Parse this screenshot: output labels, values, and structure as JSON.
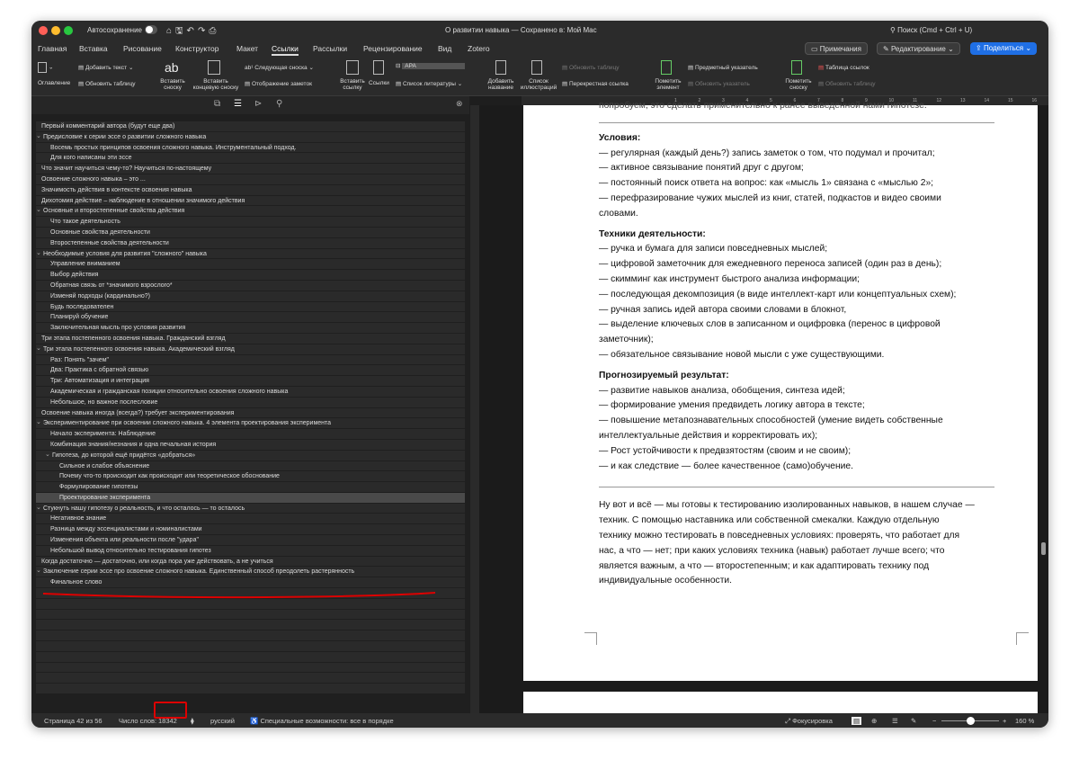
{
  "titlebar": {
    "autosave": "Автосохранение",
    "doc_title": "О развитии навыка — Сохранено в: Мой Mac",
    "search": "Поиск (Cmd + Ctrl + U)"
  },
  "menu": {
    "tabs": [
      "Главная",
      "Вставка",
      "Рисование",
      "Конструктор",
      "Макет",
      "Ссылки",
      "Рассылки",
      "Рецензирование",
      "Вид",
      "Zotero"
    ],
    "active_tab": "Ссылки",
    "comments": "Примечания",
    "editing": "Редактирование",
    "share": "Поделиться"
  },
  "ribbon": {
    "toc": "Оглавление",
    "add_text": "Добавить текст",
    "update_table": "Обновить таблицу",
    "insert_footnote": "Вставить сноску",
    "insert_endnote": "Вставить концевую сноску",
    "next_footnote": "Следующая сноска",
    "show_notes": "Отображение заметок",
    "insert_citation": "Вставить ссылку",
    "citations": "Ссылки",
    "style": "APA",
    "bibliography": "Список литературы",
    "add_caption": "Добавить название",
    "list_illustrations": "Список иллюстраций",
    "update_table2": "Обновить таблицу",
    "cross_ref": "Перекрестная ссылка",
    "mark_entry": "Пометить элемент",
    "subject_index": "Предметный указатель",
    "update_index": "Обновить указатель",
    "mark_citation": "Пометить сноску",
    "table_auth": "Таблица ссылок",
    "update_table3": "Обновить таблицу"
  },
  "ruler_ticks": [
    "1",
    "2",
    "3",
    "4",
    "5",
    "6",
    "7",
    "8",
    "9",
    "10",
    "11",
    "12",
    "13",
    "14",
    "15",
    "16",
    "17"
  ],
  "nav": {
    "items": [
      {
        "t": "Первый комментарий автора (будут еще два)",
        "l": 0,
        "c": false
      },
      {
        "t": "Предисловие к серии эссе о развитии сложного навыка",
        "l": 0,
        "c": true
      },
      {
        "t": "Восемь простых принципов освоения сложного навыка. Инструментальный подход.",
        "l": 1,
        "c": false
      },
      {
        "t": "Для кого написаны эти эссе",
        "l": 1,
        "c": false
      },
      {
        "t": "Что значит научиться чему-то? Научиться по-настоящему",
        "l": 0,
        "c": false
      },
      {
        "t": "Освоение сложного навыка – это ...",
        "l": 0,
        "c": false
      },
      {
        "t": "Значимость действия в контексте освоения навыка",
        "l": 0,
        "c": false
      },
      {
        "t": "Дихотомия действие – наблюдение в отношении значимого действия",
        "l": 0,
        "c": false
      },
      {
        "t": "Основные и второстепенные свойства действия",
        "l": 0,
        "c": true
      },
      {
        "t": "Что такое деятельность",
        "l": 1,
        "c": false
      },
      {
        "t": "Основные свойства деятельности",
        "l": 1,
        "c": false
      },
      {
        "t": "Второстепенные свойства деятельности",
        "l": 1,
        "c": false
      },
      {
        "t": "Необходимые условия для развития \"сложного\" навыка",
        "l": 0,
        "c": true
      },
      {
        "t": "Управление вниманием",
        "l": 1,
        "c": false
      },
      {
        "t": "Выбор действия",
        "l": 1,
        "c": false
      },
      {
        "t": "Обратная связь от *значимого взрослого*",
        "l": 1,
        "c": false
      },
      {
        "t": "Изменяй подходы (кардинально?)",
        "l": 1,
        "c": false
      },
      {
        "t": "Будь последователен",
        "l": 1,
        "c": false
      },
      {
        "t": "Планируй обучение",
        "l": 1,
        "c": false
      },
      {
        "t": "Заключительная мысль про условия развития",
        "l": 1,
        "c": false
      },
      {
        "t": "Три этапа постепенного освоения навыка. Гражданский взгляд",
        "l": 0,
        "c": false
      },
      {
        "t": "Три этапа постепенного освоения навыка. Академический взгляд",
        "l": 0,
        "c": true
      },
      {
        "t": "Раз: Понять \"зачем\"",
        "l": 1,
        "c": false
      },
      {
        "t": "Два: Практика с обратной связью",
        "l": 1,
        "c": false
      },
      {
        "t": "Три: Автоматизация и интеграция",
        "l": 1,
        "c": false
      },
      {
        "t": "Академическая и гражданская позиции относительно освоения сложного навыка",
        "l": 1,
        "c": false
      },
      {
        "t": "Небольшое, но важное послесловие",
        "l": 1,
        "c": false
      },
      {
        "t": "Освоение навыка иногда (всегда?) требует экспериментирования",
        "l": 0,
        "c": false
      },
      {
        "t": "Экспериментирование при освоении сложного навыка. 4 элемента проектирования эксперимента",
        "l": 0,
        "c": true
      },
      {
        "t": "Начало эксперимента: Наблюдение",
        "l": 1,
        "c": false
      },
      {
        "t": "Комбинация знания/незнания и одна печальная история",
        "l": 1,
        "c": false
      },
      {
        "t": "Гипотеза, до которой ещё придётся «добраться»",
        "l": 1,
        "c": true
      },
      {
        "t": "Сильное и слабое объяснение",
        "l": 2,
        "c": false
      },
      {
        "t": "Почему что-то происходит как происходит или теоретическое обоснование",
        "l": 2,
        "c": false
      },
      {
        "t": "Формулирование гипотезы",
        "l": 2,
        "c": false
      },
      {
        "t": "Проектирование эксперимента",
        "l": 2,
        "c": false,
        "sel": true
      },
      {
        "t": "Стукнуть нашу гипотезу о реальность, и что осталось — то осталось",
        "l": 0,
        "c": true
      },
      {
        "t": "Негативное знание",
        "l": 1,
        "c": false
      },
      {
        "t": "Разница между эссенциалистами и номиналистами",
        "l": 1,
        "c": false
      },
      {
        "t": "Изменения объекта или реальности после \"удара\"",
        "l": 1,
        "c": false
      },
      {
        "t": "Небольшой вывод относительно тестирования гипотез",
        "l": 1,
        "c": false
      },
      {
        "t": "Когда достаточно — достаточно, или когда пора уже действовать, а не учиться",
        "l": 0,
        "c": false
      },
      {
        "t": "Заключение серии эссе про освоение сложного навыка. Единственный способ преодолеть растерянность",
        "l": 0,
        "c": true
      },
      {
        "t": "Финальное слово",
        "l": 1,
        "c": false
      },
      {
        "t": "",
        "l": 0,
        "c": false
      },
      {
        "t": "",
        "l": 0,
        "c": false
      },
      {
        "t": "",
        "l": 0,
        "c": false
      },
      {
        "t": "",
        "l": 0,
        "c": false
      },
      {
        "t": "",
        "l": 0,
        "c": false
      },
      {
        "t": "",
        "l": 0,
        "c": false
      },
      {
        "t": "",
        "l": 0,
        "c": false
      },
      {
        "t": "",
        "l": 0,
        "c": false
      },
      {
        "t": "",
        "l": 0,
        "c": false
      },
      {
        "t": "",
        "l": 0,
        "c": false
      }
    ]
  },
  "doc": {
    "top_cut": "попробуем, это сделать применительно к ранее выведенной нами гипотезе.",
    "h_conditions": "Условия:",
    "conditions": [
      "— регулярная (каждый день?) запись заметок о том, что подумал и прочитал;",
      "— активное связывание понятий друг с другом;",
      "— постоянный поиск ответа на вопрос: как «мысль 1» связана с «мыслью 2»;",
      "— перефразирование чужих мыслей из книг, статей, подкастов и видео своими",
      "словами."
    ],
    "h_techniques": "Техники деятельности:",
    "techniques": [
      "— ручка и бумага для записи повседневных мыслей;",
      "— цифровой заметочник для ежедневного переноса записей (один раз в день);",
      "— скимминг как инструмент быстрого анализа информации;",
      "— последующая декомпозиция (в виде интеллект-карт или концептуальных схем);",
      "— ручная запись идей автора своими словами в блокнот,",
      "— выделение ключевых слов в записанном и оцифровка (перенос в цифровой",
      "заметочник);",
      "— обязательное связывание новой мысли с уже существующими."
    ],
    "h_result": "Прогнозируемый результат:",
    "results": [
      "— развитие навыков анализа, обобщения, синтеза идей;",
      "— формирование умения предвидеть логику автора в тексте;",
      "— повышение метапознавательных способностей (умение видеть собственные",
      "интеллектуальные действия и корректировать их);",
      "— Рост устойчивости к предвзятостям (своим и не своим);",
      "— и как следствие — более качественное (само)обучение."
    ],
    "final": [
      "Ну вот и всё — мы готовы к тестированию изолированных навыков, в нашем случае —",
      "техник. С помощью наставника или собственной смекалки. Каждую отдельную",
      "технику можно тестировать в повседневных условиях: проверять, что работает для",
      "нас, а что — нет; при каких условиях техника (навык) работает лучше всего; что",
      "является важным, а что — второстепенным; и как адаптировать технику под",
      "индивидуальные особенности."
    ]
  },
  "status": {
    "page": "Страница 42 из 56",
    "words_label": "Число слов:",
    "words": "18342",
    "lang": "русский",
    "accessibility": "Специальные возможности: все в порядке",
    "focus": "Фокусировка",
    "zoom": "160 %"
  },
  "colors": {
    "accent": "#1f6fe5",
    "annotation": "#d00000"
  }
}
